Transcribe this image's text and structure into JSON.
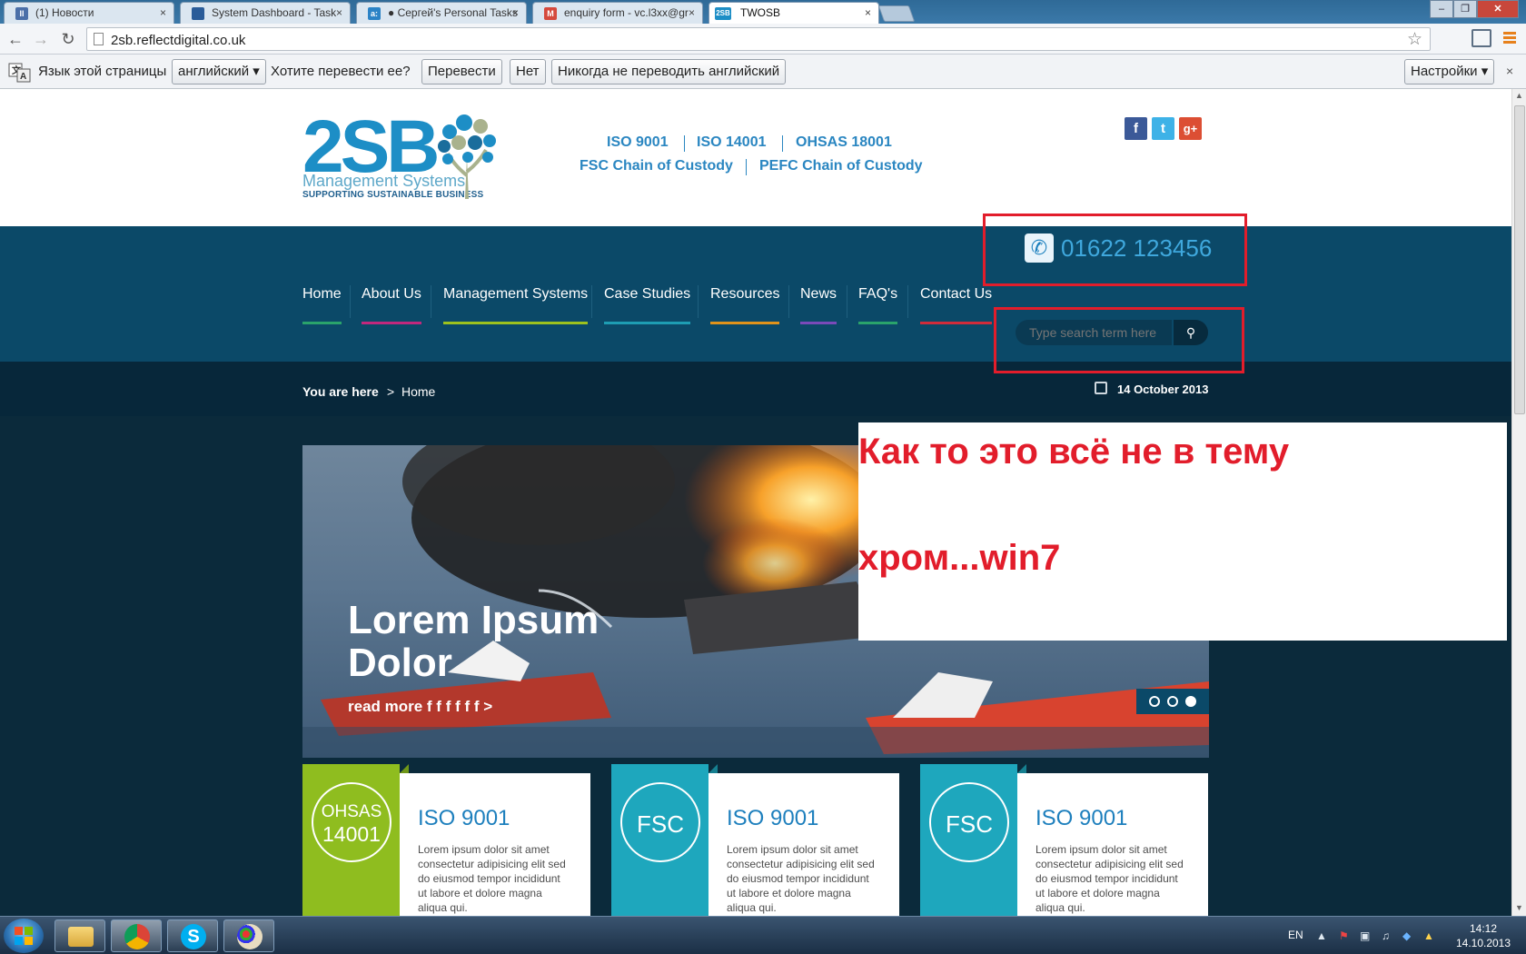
{
  "browser": {
    "tabs": [
      {
        "label": "(1) Новости",
        "fav_color": "#4b6fa8",
        "fav": "II",
        "active": false
      },
      {
        "label": "System Dashboard - Task",
        "fav_color": "#2a5c99",
        "fav": "",
        "active": false
      },
      {
        "label": "● Сергей's Personal Tasks",
        "fav_color": "#2b83c6",
        "fav": "a:",
        "active": false
      },
      {
        "label": "enquiry form - vc.l3xx@gr",
        "fav_color": "#d5493c",
        "fav": "M",
        "active": false
      },
      {
        "label": "TWOSB",
        "fav_color": "#1d8ec6",
        "fav": "2SB",
        "active": true
      }
    ],
    "tab_close": "×",
    "window_controls": {
      "minimize": "–",
      "maximize": "❐",
      "close": "✕"
    },
    "url": "2sb.reflectdigital.co.uk",
    "back_icon": "←",
    "forward_icon": "→",
    "reload_icon": "↻",
    "star_icon": "☆"
  },
  "translate_bar": {
    "label": "Язык этой страницы",
    "language": "английский ▾",
    "question": "Хотите перевести ее?",
    "translate": "Перевести",
    "no": "Нет",
    "never": "Никогда не переводить английский",
    "settings": "Настройки ▾",
    "close": "×"
  },
  "site": {
    "logo": {
      "brand": "2SB",
      "sub": "Management Systems",
      "tagline": "SUPPORTING SUSTAINABLE BUSINESS"
    },
    "certs_row1": [
      "ISO 9001",
      "ISO 14001",
      "OHSAS 18001"
    ],
    "certs_row2": [
      "FSC Chain of Custody",
      "PEFC Chain of Custody"
    ],
    "social": {
      "facebook": "f",
      "twitter": "t",
      "google": "g+"
    },
    "phone": "01622 123456",
    "nav": [
      {
        "label": "Home",
        "color": "#2aa36b"
      },
      {
        "label": "About Us",
        "color": "#c2287d"
      },
      {
        "label": "Management Systems",
        "color": "#9dc21e"
      },
      {
        "label": "Case Studies",
        "color": "#1e9db3"
      },
      {
        "label": "Resources",
        "color": "#e1931b"
      },
      {
        "label": "News",
        "color": "#7a4ab9"
      },
      {
        "label": "FAQ's",
        "color": "#2aa36b"
      },
      {
        "label": "Contact Us",
        "color": "#d12c3a"
      }
    ],
    "search_placeholder": "Type search term here",
    "breadcrumb": {
      "label": "You are here",
      "sep": ">",
      "current": "Home"
    },
    "date": "14 October 2013",
    "slide": {
      "title": "Lorem Ipsum Dolor",
      "more": "read more f f f f f f  >",
      "dots_total": 3,
      "active_dot": 3
    },
    "cards": [
      {
        "badge_line1": "OHSAS",
        "badge_line2": "14001",
        "badge_color": "#8fbd1f",
        "title": "ISO 9001",
        "text": "Lorem ipsum dolor sit amet consectetur adipisicing elit sed do eiusmod tempor incididunt ut labore et dolore magna aliqua qui."
      },
      {
        "badge_line1": "FSC",
        "badge_line2": "",
        "badge_color": "#1ea7bd",
        "title": "ISO 9001",
        "text": "Lorem ipsum dolor sit amet consectetur adipisicing elit sed do eiusmod tempor incididunt ut labore et dolore magna aliqua qui."
      },
      {
        "badge_line1": "FSC",
        "badge_line2": "",
        "badge_color": "#1ea7bd",
        "title": "ISO 9001",
        "text": "Lorem ipsum dolor sit amet consectetur adipisicing elit sed do eiusmod tempor incididunt ut labore et dolore magna aliqua qui."
      }
    ]
  },
  "annotation": {
    "line1": "Как то это всё не в тему",
    "line2": "хром...win7",
    "color": "#e21d2b"
  },
  "taskbar": {
    "apps": [
      "file-explorer",
      "chrome",
      "skype",
      "paint"
    ],
    "lang": "EN",
    "time": "14:12",
    "date": "14.10.2013"
  }
}
